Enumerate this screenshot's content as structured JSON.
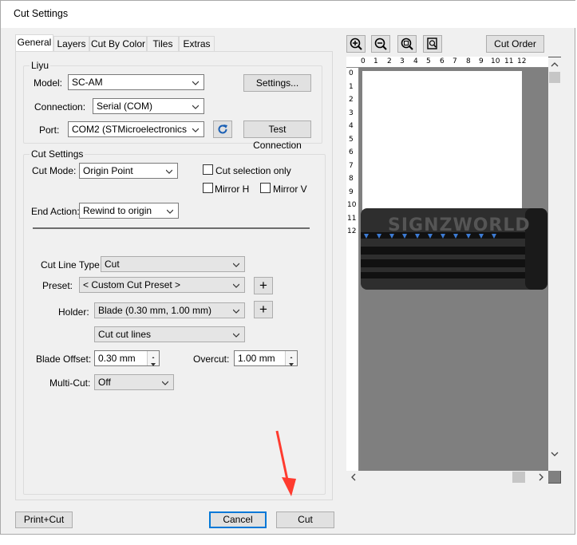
{
  "window": {
    "title": "Cut Settings"
  },
  "tabs": [
    "General",
    "Layers",
    "Cut By Color",
    "Tiles",
    "Extras"
  ],
  "device_group": {
    "label": "Liyu",
    "model_label": "Model:",
    "model_value": "SC-AM",
    "settings_button": "Settings...",
    "connection_label": "Connection:",
    "connection_value": "Serial (COM)",
    "port_label": "Port:",
    "port_value": "COM2 (STMicroelectronics Virtu",
    "test_button": "Test Connection"
  },
  "cut_group": {
    "label": "Cut Settings",
    "cut_mode_label": "Cut Mode:",
    "cut_mode_value": "Origin Point",
    "cut_selection_label": "Cut selection only",
    "mirror_h_label": "Mirror H",
    "mirror_v_label": "Mirror V",
    "end_action_label": "End Action:",
    "end_action_value": "Rewind to origin",
    "line_type_label": "Cut Line Type:",
    "line_type_value": "Cut",
    "preset_label": "Preset:",
    "preset_value": "< Custom Cut Preset >",
    "holder_label": "Holder:",
    "holder_value": "Blade (0.30 mm, 1.00 mm)",
    "cut_lines_value": "Cut cut lines",
    "blade_offset_label": "Blade Offset:",
    "blade_offset_value": "0.30 mm",
    "overcut_label": "Overcut:",
    "overcut_value": "1.00 mm",
    "multicut_label": "Multi-Cut:",
    "multicut_value": "Off"
  },
  "preview": {
    "cut_order_button": "Cut Order",
    "ruler_top": [
      "0",
      "1",
      "2",
      "3",
      "4",
      "5",
      "6",
      "7",
      "8",
      "9",
      "10",
      "11",
      "12"
    ],
    "ruler_left": [
      "0",
      "1",
      "2",
      "3",
      "4",
      "5",
      "6",
      "7",
      "8",
      "9",
      "10",
      "11",
      "12"
    ],
    "brand_text": "SIGNZWORLD"
  },
  "footer": {
    "print_cut": "Print+Cut",
    "cancel": "Cancel",
    "cut": "Cut"
  },
  "colors": {
    "accent": "#0078d7",
    "dialog_bg": "#f0f0f0",
    "preview_bg": "#808080",
    "annotation_arrow": "#ff3b2f"
  }
}
